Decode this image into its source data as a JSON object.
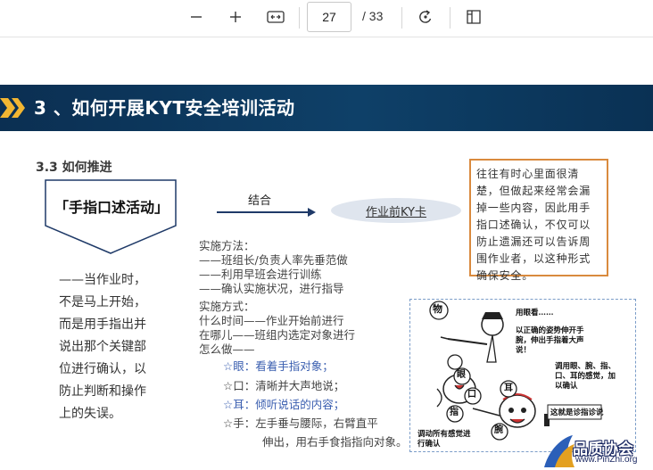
{
  "toolbar": {
    "zoom_out_icon": "minus-icon",
    "zoom_in_icon": "plus-icon",
    "fit_width_icon": "fit-width-icon",
    "current_page": "27",
    "total_pages": "/ 33",
    "rotate_icon": "rotate-icon",
    "page_view_icon": "page-view-icon"
  },
  "slide": {
    "banner_title": "3 、如何开展KYT安全培训活动",
    "section_title": "3.3 如何推进",
    "pentagon_label": "「手指口述活动」",
    "arrow_label": "结合",
    "oval_label": "作业前KY卡",
    "description": [
      "——当作业时，",
      "不是马上开始，",
      "而是用手指出并",
      "说出那个关键部",
      "位进行确认，以",
      "防止判断和操作",
      "上的失误。"
    ],
    "note": "往往有时心里面很清楚，但做起来经常会漏掉一些内容，因此用手指口述确认，不仅可以防止遗漏还可以告诉周围作业者，以这种形式确保安全。",
    "methods_title": "实施方法：",
    "methods": [
      "——班组长/负责人率先垂范做",
      "——利用早班会进行训练",
      "——确认实施状况，进行指导"
    ],
    "ways_title": "实施方式：",
    "ways": [
      "什么时间——作业开始前进行",
      "在哪儿——班组内选定对象进行",
      "怎么做——"
    ],
    "steps": [
      {
        "label": "☆眼：看着手指对象；"
      },
      {
        "label": "☆口：清晰并大声地说；"
      },
      {
        "label": "☆耳：倾听说话的内容；"
      },
      {
        "label": "☆手：左手垂与腰际，右臂直平"
      },
      {
        "label": "伸出，用右手食指指向对象。"
      }
    ],
    "illustration": {
      "thing": "物",
      "look": "用眼看……",
      "posture": "以正确的姿势伸开手腕，伸出手指着大声说！",
      "senses": "调用眼、腕、指、口、耳的感觉，加以确认",
      "confirm": "这就是诊指诊说",
      "mobilize": "调动所有感觉进行确认",
      "eye": "眼",
      "ear": "耳",
      "mouth": "口",
      "finger": "指",
      "wrist": "腕"
    }
  },
  "watermark": {
    "name": "品质协会",
    "url": "www.PinZhi.org"
  },
  "colors": {
    "banner": "#0e4068",
    "chevron": "#f2b632",
    "note_border": "#d98a3e",
    "blue_text": "#3b5fb0"
  }
}
